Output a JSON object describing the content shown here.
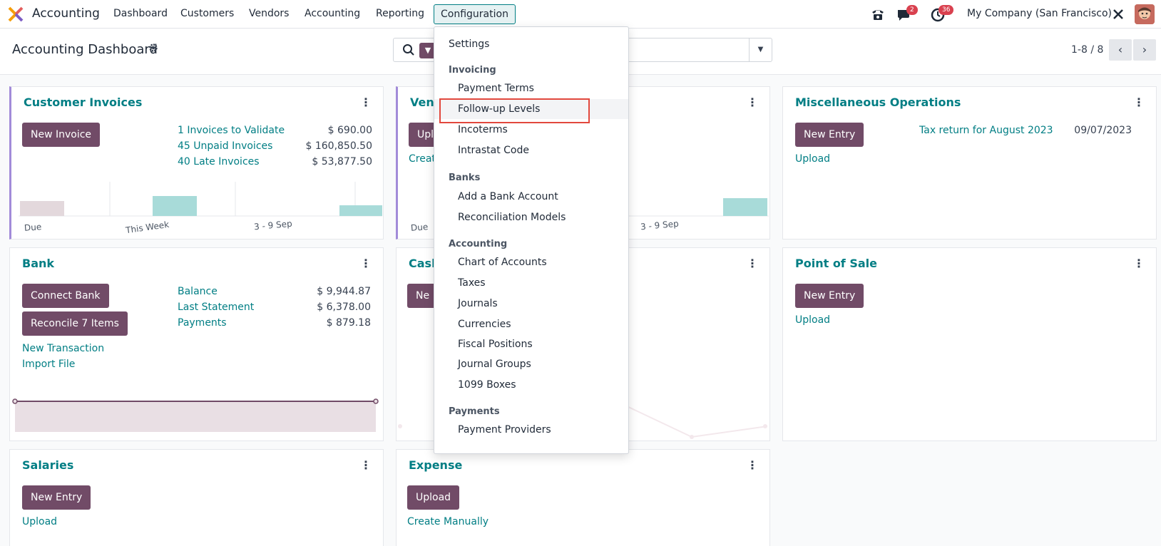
{
  "navbar": {
    "app_name": "Accounting",
    "menu": [
      "Dashboard",
      "Customers",
      "Vendors",
      "Accounting",
      "Reporting",
      "Configuration"
    ],
    "messages_badge": "2",
    "activities_badge": "36",
    "company": "My Company (San Francisco)"
  },
  "control_panel": {
    "title": "Accounting Dashboard",
    "pager": "1-8 / 8"
  },
  "cards": {
    "customer_invoices": {
      "title": "Customer Invoices",
      "button": "New Invoice",
      "rows": [
        {
          "label": "1 Invoices to Validate",
          "amount": "$ 690.00"
        },
        {
          "label": "45 Unpaid Invoices",
          "amount": "$ 160,850.50"
        },
        {
          "label": "40 Late Invoices",
          "amount": "$ 53,877.50"
        }
      ],
      "axis": [
        "Due",
        "This Week",
        "3 - 9 Sep"
      ]
    },
    "vendor_bills": {
      "title": "Vend",
      "button": "Upl",
      "link": "Creat",
      "axis": [
        "Due",
        "3 - 9 Sep"
      ]
    },
    "misc": {
      "title": "Miscellaneous Operations",
      "button": "New Entry",
      "upload": "Upload",
      "tax_label": "Tax return for August 2023",
      "tax_date": "09/07/2023"
    },
    "bank": {
      "title": "Bank",
      "btn_connect": "Connect Bank",
      "btn_reconcile": "Reconcile 7 Items",
      "link_new": "New Transaction",
      "link_import": "Import File",
      "rows": [
        {
          "label": "Balance",
          "amount": "$ 9,944.87"
        },
        {
          "label": "Last Statement",
          "amount": "$ 6,378.00"
        },
        {
          "label": "Payments",
          "amount": "$ 879.18"
        }
      ]
    },
    "cash": {
      "title": "Cash",
      "button": "Ne"
    },
    "pos": {
      "title": "Point of Sale",
      "button": "New Entry",
      "upload": "Upload"
    },
    "salaries": {
      "title": "Salaries",
      "button": "New Entry",
      "upload": "Upload"
    },
    "expense": {
      "title": "Expense",
      "button": "Upload",
      "link": "Create Manually"
    }
  },
  "dropdown": {
    "settings": "Settings",
    "invoicing_header": "Invoicing",
    "invoicing": [
      "Payment Terms",
      "Follow-up Levels",
      "Incoterms",
      "Intrastat Code"
    ],
    "banks_header": "Banks",
    "banks": [
      "Add a Bank Account",
      "Reconciliation Models"
    ],
    "accounting_header": "Accounting",
    "accounting": [
      "Chart of Accounts",
      "Taxes",
      "Journals",
      "Currencies",
      "Fiscal Positions",
      "Journal Groups",
      "1099 Boxes"
    ],
    "payments_header": "Payments",
    "payments": [
      "Payment Providers"
    ]
  },
  "colors": {
    "primary": "#714b67",
    "link": "#017e84",
    "highlight": "#e2483d",
    "bar_past": "#e3d8dc",
    "bar_future": "#a8dbd9"
  }
}
